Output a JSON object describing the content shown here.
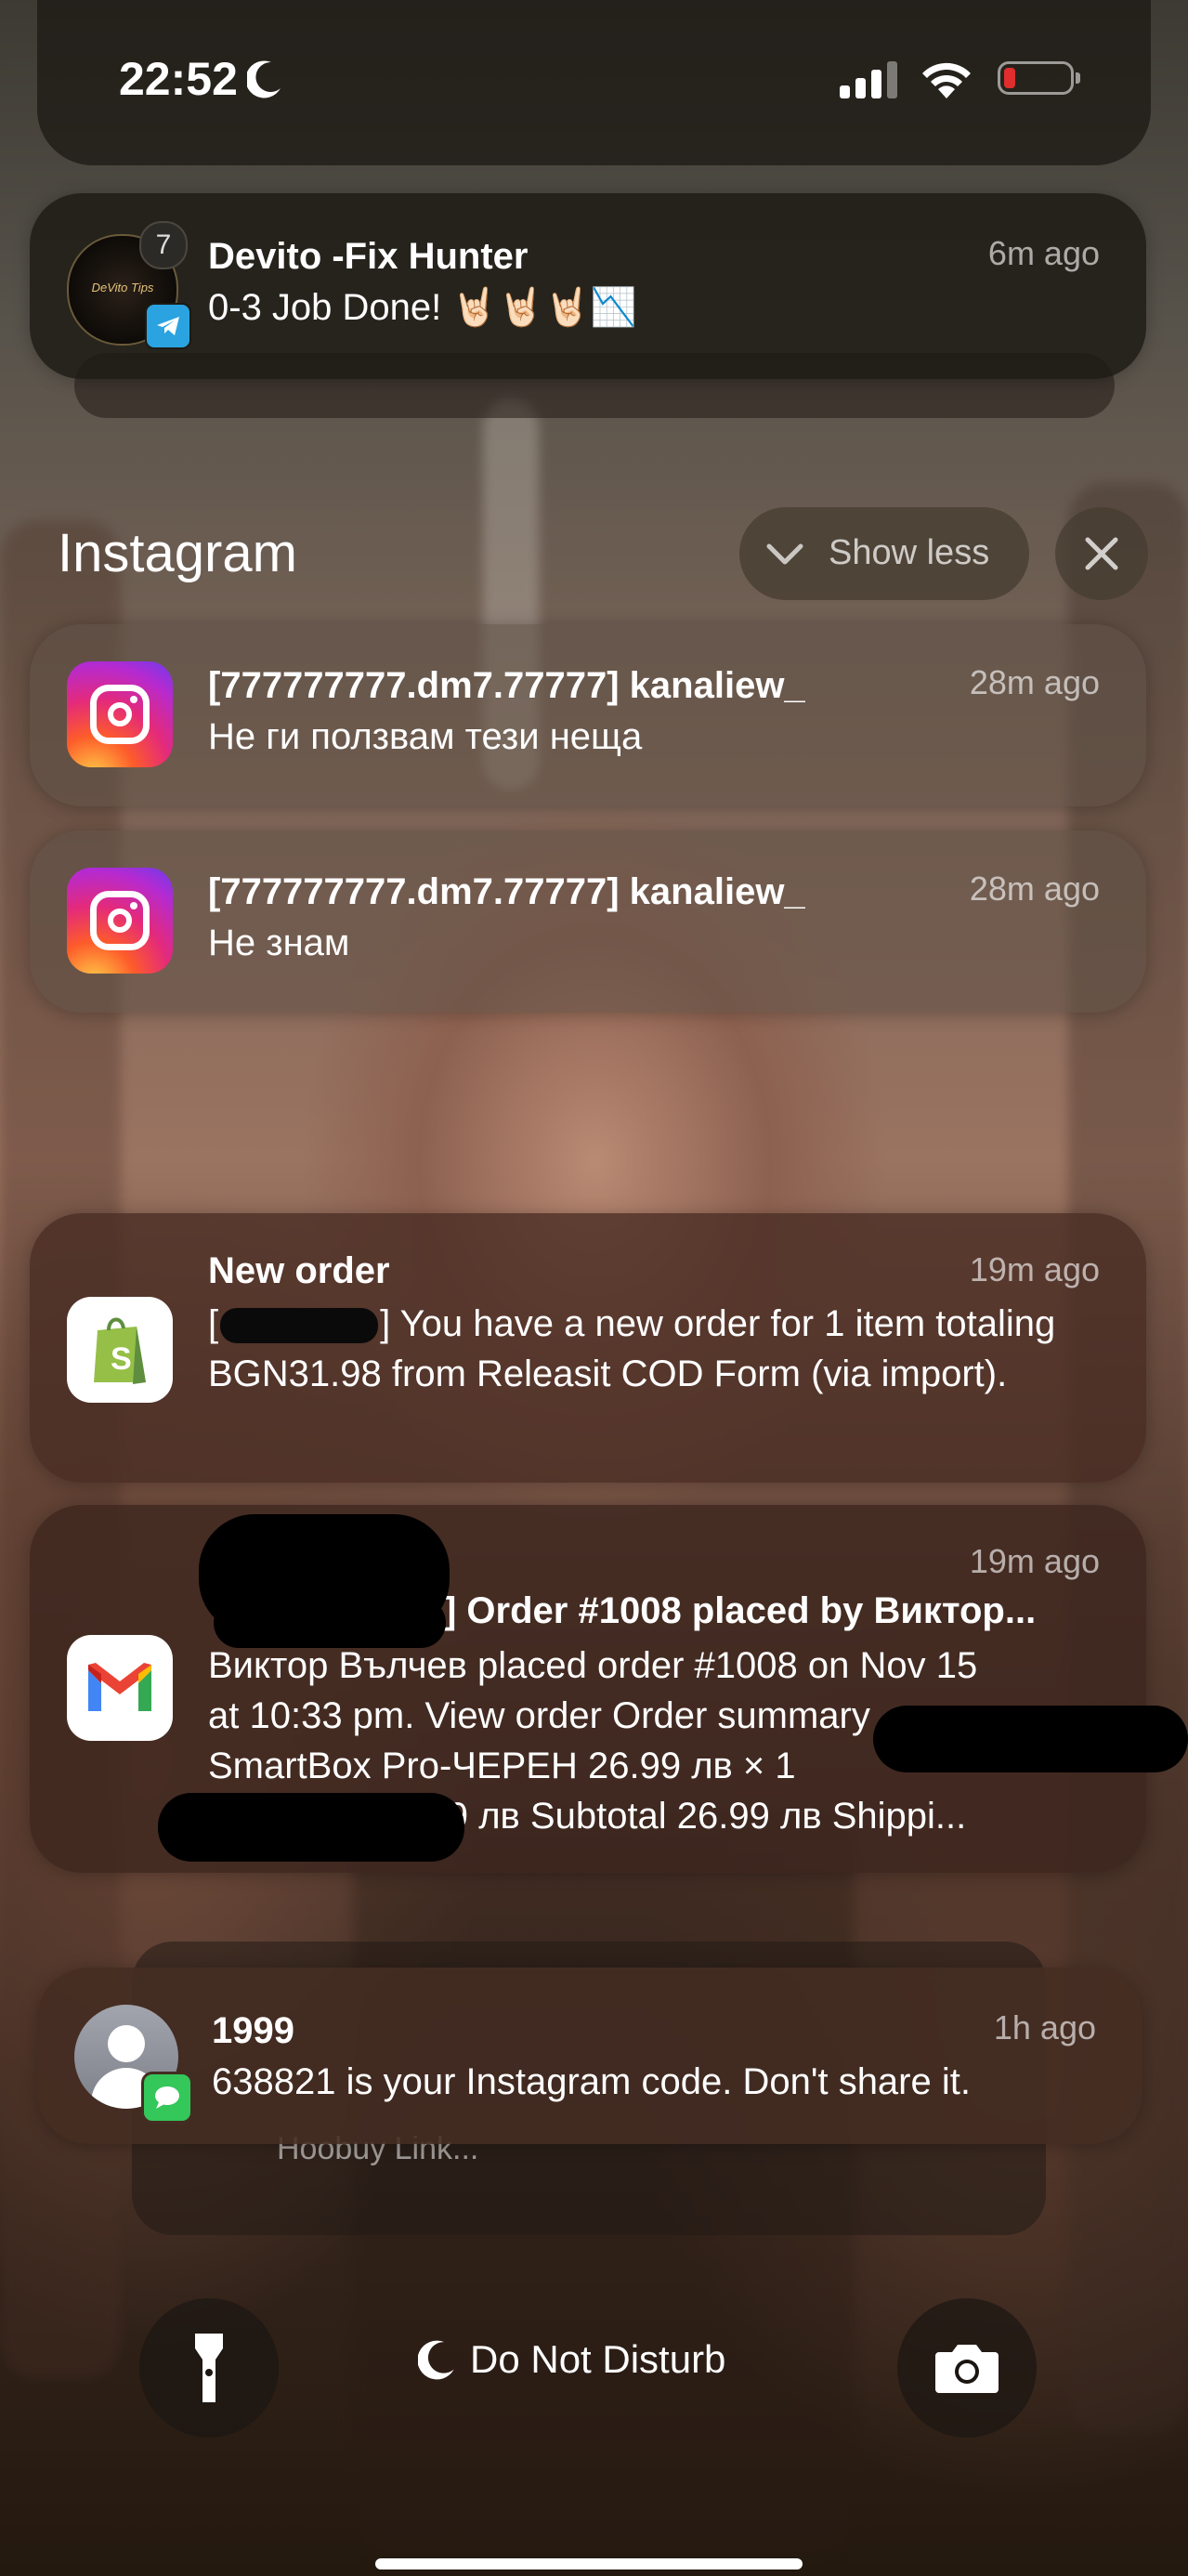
{
  "status_bar": {
    "time": "22:52",
    "dnd_icon": "moon-icon",
    "signal_icon": "cellular-signal-icon",
    "wifi_icon": "wifi-icon",
    "battery_icon": "battery-low-icon",
    "battery_color": "#e02d2d"
  },
  "telegram_notification": {
    "title": "Devito -Fix Hunter",
    "time": "6m ago",
    "message": "0-3 Job Done! 🤘🏻🤘🏻🤘🏻📉",
    "badge_count": "7",
    "avatar_text": "DeVito Tips",
    "app_icon": "telegram-icon",
    "accent_color": "#2aa3e0"
  },
  "instagram_group": {
    "header": "Instagram",
    "show_less_label": "Show less",
    "close_icon": "close-icon",
    "items": [
      {
        "title": "[777777777.dm7.77777] kanaliew_",
        "time": "28m ago",
        "message": "Не ги ползвам тези неща"
      },
      {
        "title": "[777777777.dm7.77777] kanaliew_",
        "time": "28m ago",
        "message": "Не знам"
      }
    ]
  },
  "shopify_notification": {
    "title": "New order",
    "time": "19m ago",
    "message_prefix": "[",
    "message_visible_bracket": "]",
    "message": "You have a new order for 1 item totaling BGN31.98 from Releasit COD Form (via import).",
    "app_icon": "shopify-bag-icon",
    "accent_color": "#95bf47"
  },
  "gmail_notification": {
    "title": "] Order #1008 placed by Виктор...",
    "time": "19m ago",
    "message_lines": [
      "Виктор Вълчев placed order #1008 on Nov 15",
      "at 10:33 pm. View order Order summary",
      "SmartBox Pro-ЧЕРЕН 26.99 лв × 1",
      "(PHONE) 26.99 лв Subtotal 26.99 лв Shippi..."
    ],
    "app_icon": "gmail-icon"
  },
  "messages_notification": {
    "title": "1999",
    "time": "1h ago",
    "message": "638821 is your Instagram code. Don't share it.",
    "avatar_icon": "contact-avatar-icon",
    "app_badge_icon": "messages-icon",
    "stacked_peek": "Hoobuy Link..."
  },
  "bottom_controls": {
    "flashlight_icon": "flashlight-icon",
    "focus_label": "Do Not Disturb",
    "focus_icon": "moon-icon",
    "camera_icon": "camera-icon"
  }
}
